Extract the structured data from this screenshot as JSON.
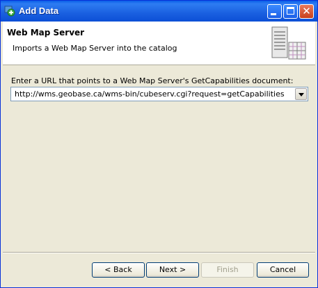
{
  "window": {
    "title": "Add Data"
  },
  "header": {
    "title": "Web Map Server",
    "description": "Imports a Web Map Server into the catalog"
  },
  "form": {
    "url_label": "Enter a URL that points to a Web Map Server's GetCapabilities document:",
    "url_value": "http://wms.geobase.ca/wms-bin/cubeserv.cgi?request=getCapabilities"
  },
  "buttons": {
    "back": "< Back",
    "next": "Next >",
    "finish": "Finish",
    "cancel": "Cancel"
  },
  "colors": {
    "titlebar": "#0a5fe8",
    "dialog_bg": "#ece9d8",
    "close_button": "#d45a37"
  }
}
